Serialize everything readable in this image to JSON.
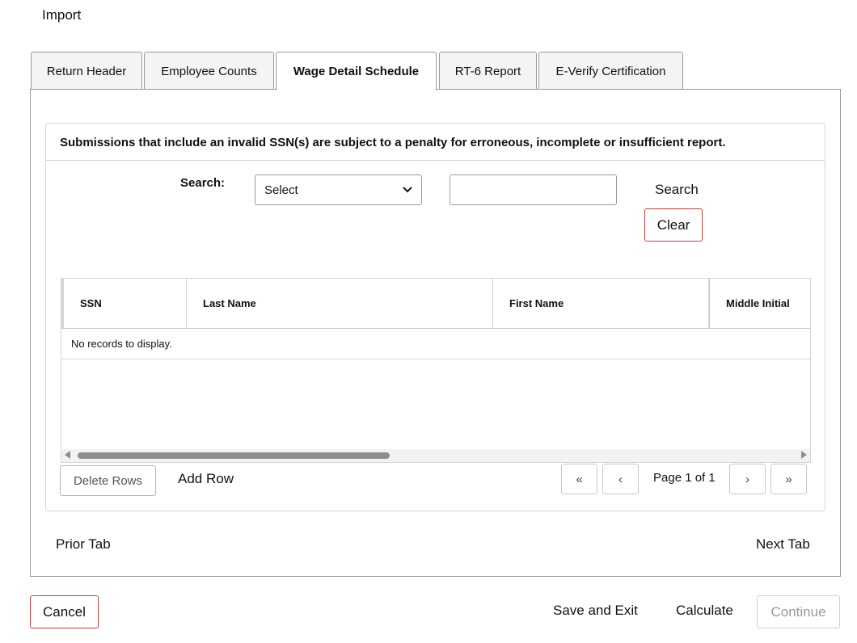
{
  "page": {
    "import_label": "Import"
  },
  "tabs": [
    {
      "label": "Return Header"
    },
    {
      "label": "Employee Counts"
    },
    {
      "label": "Wage Detail Schedule",
      "active": true
    },
    {
      "label": "RT-6 Report"
    },
    {
      "label": "E-Verify Certification"
    }
  ],
  "card": {
    "notice": "Submissions that include an invalid SSN(s) are subject to a penalty for erroneous, incomplete or insufficient report."
  },
  "search": {
    "label": "Search:",
    "select_value": "Select",
    "text_value": "",
    "search_button": "Search",
    "clear_button": "Clear"
  },
  "grid": {
    "columns": [
      "SSN",
      "Last Name",
      "First Name",
      "Middle Initial"
    ],
    "empty_message": "No records to display."
  },
  "grid_actions": {
    "delete_rows": "Delete Rows",
    "add_row": "Add Row"
  },
  "pager": {
    "first": "«",
    "prev": "‹",
    "page_text": "Page 1 of 1",
    "next": "›",
    "last": "»"
  },
  "tab_nav": {
    "prior": "Prior Tab",
    "next": "Next Tab"
  },
  "footer": {
    "cancel": "Cancel",
    "save_exit": "Save and Exit",
    "calculate": "Calculate",
    "continue": "Continue"
  },
  "colors": {
    "accent_red": "#c8413a",
    "border_gray": "#9a9a9a"
  }
}
